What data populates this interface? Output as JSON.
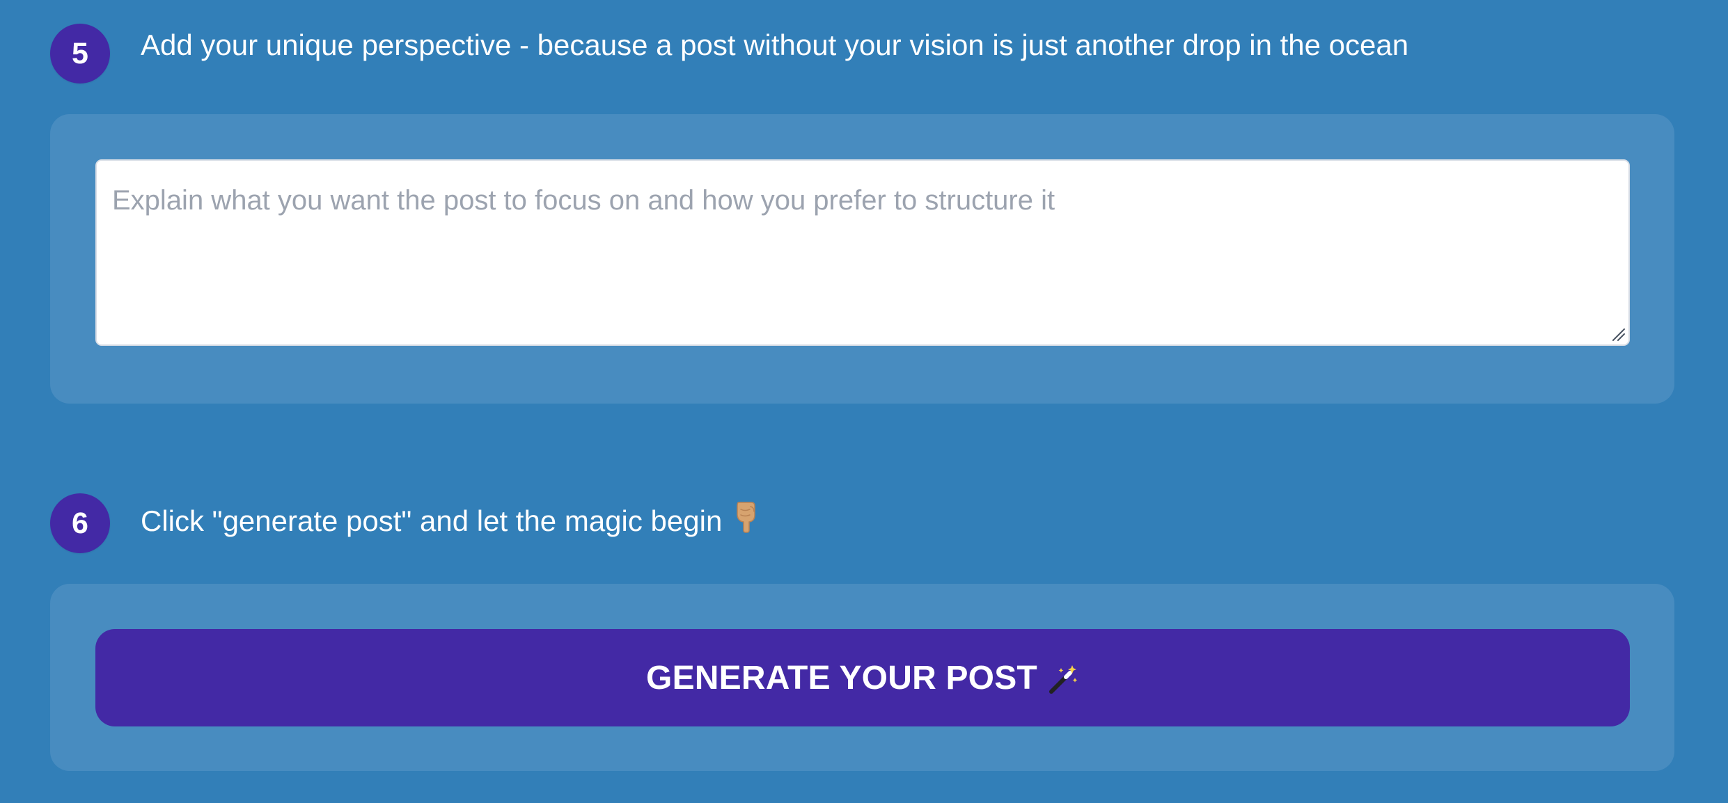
{
  "steps": [
    {
      "number": "5",
      "title": "Add your unique perspective - because a post without your vision is just another drop in the ocean",
      "input": {
        "placeholder": "Explain what you want the post to focus on and how you prefer to structure it",
        "value": ""
      }
    },
    {
      "number": "6",
      "title": "Click \"generate post\" and let the magic begin",
      "title_icon": "pointing-down-icon",
      "button": {
        "label": "GENERATE YOUR POST",
        "icon": "magic-wand-icon"
      }
    }
  ],
  "colors": {
    "background": "#327fb8",
    "panel": "#488cc0",
    "accent": "#4329a5",
    "input_background": "#ffffff",
    "placeholder": "#9ca3af"
  }
}
